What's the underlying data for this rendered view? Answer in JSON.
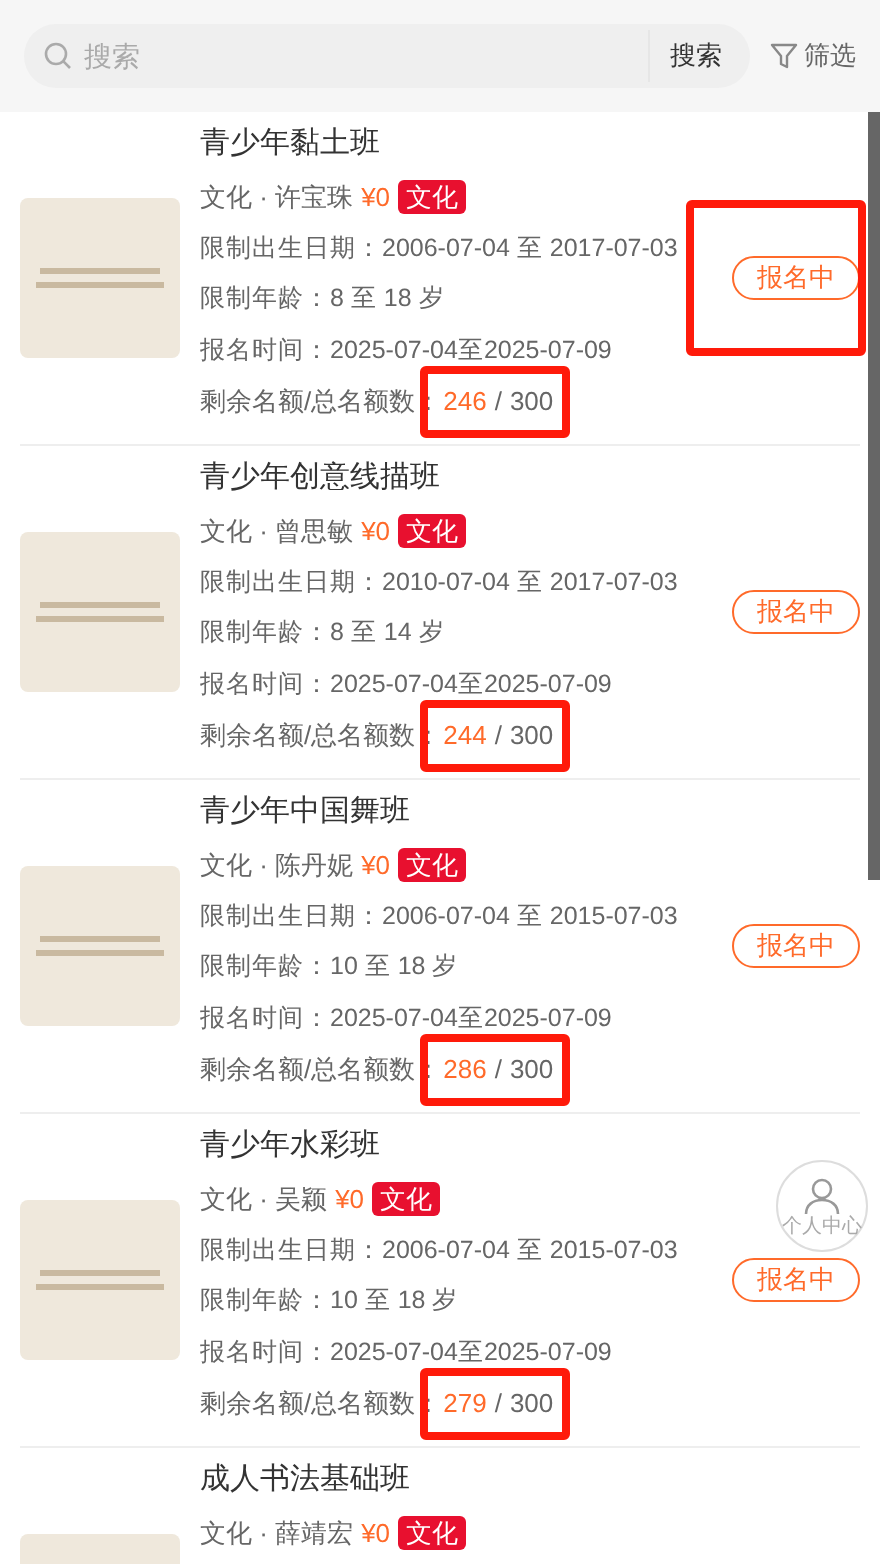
{
  "search": {
    "placeholder": "搜索",
    "button": "搜索"
  },
  "filter": {
    "label": "筛选"
  },
  "courses": [
    {
      "title": "青少年黏土班",
      "category": "文化 · 许宝珠",
      "price": "¥0",
      "tag": "文化",
      "birth": "限制出生日期：2006-07-04 至 2017-07-03",
      "age": "限制年龄：8 至 18 岁",
      "period": "报名时间：2025-07-04至2025-07-09",
      "quota_label": "剩余名额/总名额数：",
      "remaining": "246",
      "separator": "/",
      "total": "300",
      "status": "报名中",
      "button_highlighted": true,
      "quota_highlighted": true
    },
    {
      "title": "青少年创意线描班",
      "category": "文化 · 曾思敏",
      "price": "¥0",
      "tag": "文化",
      "birth": "限制出生日期：2010-07-04 至 2017-07-03",
      "age": "限制年龄：8 至 14 岁",
      "period": "报名时间：2025-07-04至2025-07-09",
      "quota_label": "剩余名额/总名额数：",
      "remaining": "244",
      "separator": "/",
      "total": "300",
      "status": "报名中",
      "button_highlighted": false,
      "quota_highlighted": true
    },
    {
      "title": "青少年中国舞班",
      "category": "文化 · 陈丹妮",
      "price": "¥0",
      "tag": "文化",
      "birth": "限制出生日期：2006-07-04 至 2015-07-03",
      "age": "限制年龄：10 至 18 岁",
      "period": "报名时间：2025-07-04至2025-07-09",
      "quota_label": "剩余名额/总名额数：",
      "remaining": "286",
      "separator": "/",
      "total": "300",
      "status": "报名中",
      "button_highlighted": false,
      "quota_highlighted": true
    },
    {
      "title": "青少年水彩班",
      "category": "文化 · 吴颖",
      "price": "¥0",
      "tag": "文化",
      "birth": "限制出生日期：2006-07-04 至 2015-07-03",
      "age": "限制年龄：10 至 18 岁",
      "period": "报名时间：2025-07-04至2025-07-09",
      "quota_label": "剩余名额/总名额数：",
      "remaining": "279",
      "separator": "/",
      "total": "300",
      "status": "报名中",
      "button_highlighted": false,
      "quota_highlighted": true
    },
    {
      "title": "成人书法基础班",
      "category": "文化 · 薛靖宏",
      "price": "¥0",
      "tag": "文化"
    }
  ],
  "floating_button": {
    "label": "个人中心"
  }
}
